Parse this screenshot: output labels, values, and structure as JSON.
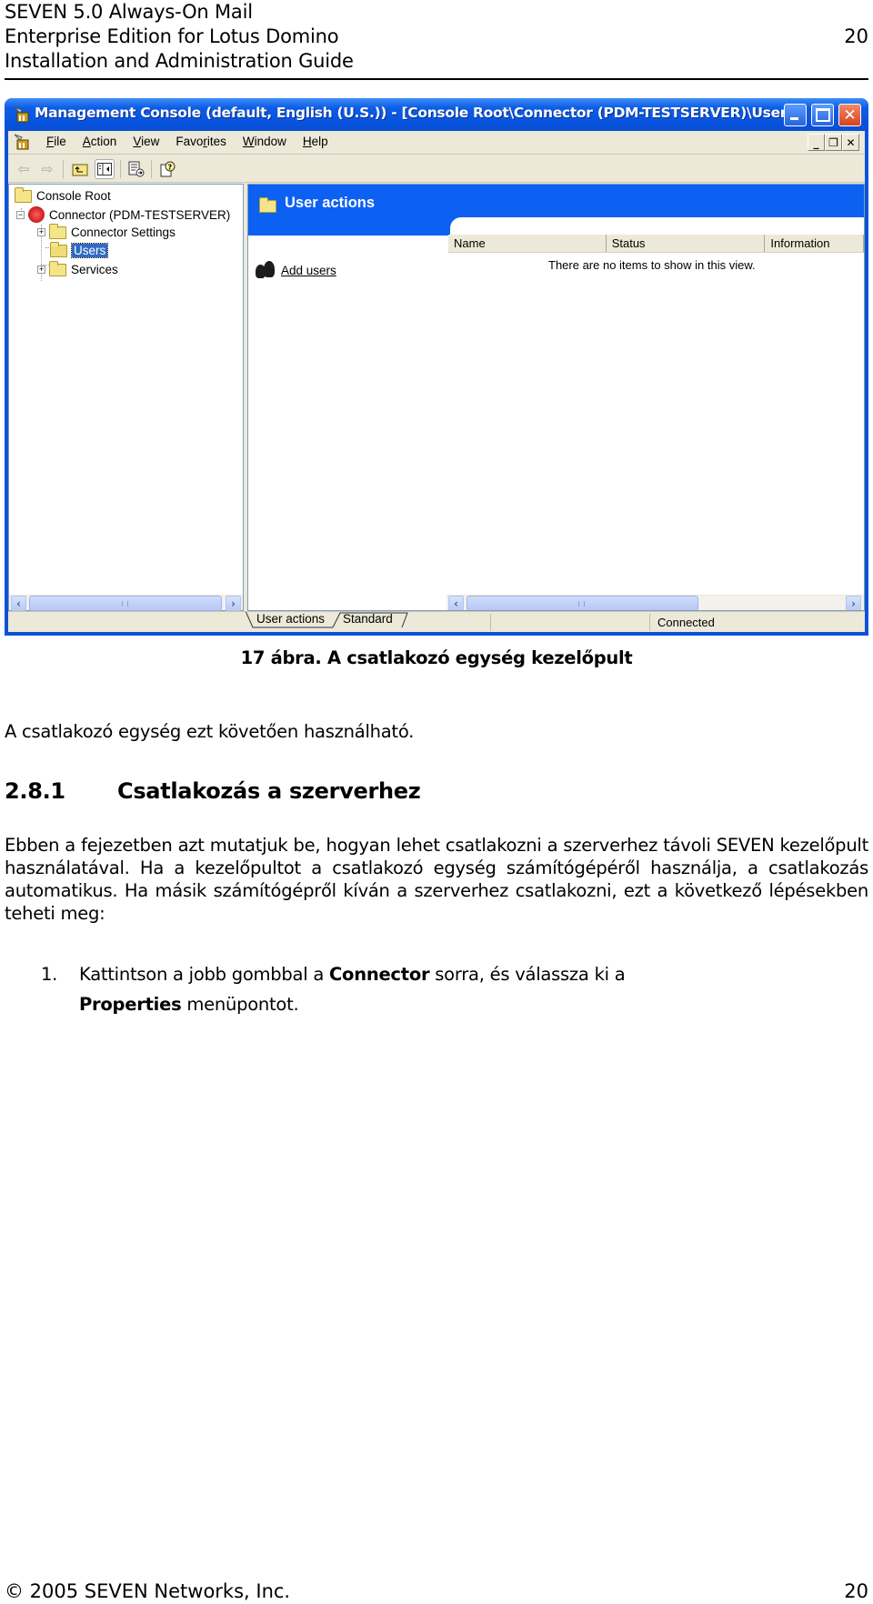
{
  "header": {
    "lines": [
      "SEVEN 5.0 Always-On Mail",
      "Enterprise Edition for Lotus Domino",
      "Installation and Administration Guide"
    ],
    "page_number": "20"
  },
  "screenshot": {
    "window_title": "Management Console (default, English (U.S.)) - [Console Root\\Connector (PDM-TESTSERVER)\\Users]",
    "menus": [
      {
        "accel": "F",
        "rest": "ile"
      },
      {
        "accel": "A",
        "rest": "ction"
      },
      {
        "accel": "V",
        "rest": "iew"
      },
      {
        "pre": "Favo",
        "accel": "r",
        "rest": "ites"
      },
      {
        "accel": "W",
        "rest": "indow"
      },
      {
        "accel": "H",
        "rest": "elp"
      }
    ],
    "menu_labels": [
      "File",
      "Action",
      "View",
      "Favorites",
      "Window",
      "Help"
    ],
    "toolbar_icons": [
      "back-arrow-icon",
      "forward-arrow-icon",
      "up-one-level-icon",
      "show-hide-tree-icon",
      "export-list-icon",
      "help-icon"
    ],
    "tree": {
      "root": "Console Root",
      "connector": "Connector (PDM-TESTSERVER)",
      "children": [
        "Connector Settings",
        "Users",
        "Services"
      ],
      "selected": "Users"
    },
    "taskpad": {
      "title": "User actions",
      "task_link": "Add users",
      "columns": [
        "Name",
        "Status",
        "Information"
      ],
      "empty_message": "There are no items to show in this view."
    },
    "tabs": [
      "User actions",
      "Standard"
    ],
    "active_tab": "User actions",
    "status": "Connected"
  },
  "document": {
    "caption": "17 ábra. A csatlakozó egység kezelőpult",
    "intro": "A csatlakozó egység ezt követően használható.",
    "section_number": "2.8.1",
    "section_title": "Csatlakozás a szerverhez",
    "body": "Ebben a fejezetben azt mutatjuk be, hogyan lehet csatlakozni a szerverhez távoli SEVEN kezelőpult használatával. Ha a kezelőpultot a csatlakozó egység számítógépéről használja, a csatlakozás automatikus. Ha másik számítógépről kíván a szerverhez csatlakozni, ezt a következő lépésekben teheti meg:",
    "steps": [
      {
        "marker": "1.",
        "parts": [
          "Kattintson a jobb gombbal a ",
          "Connector",
          " sorra, és válassza ki a ",
          "Properties",
          " menüpontot."
        ]
      }
    ]
  },
  "footer": {
    "copyright": "© 2005 SEVEN Networks, Inc.",
    "page_number": "20"
  }
}
